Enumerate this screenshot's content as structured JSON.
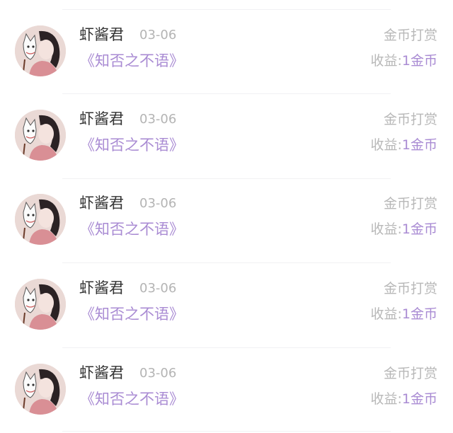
{
  "items": [
    {
      "user": "虾酱君",
      "date": "03-06",
      "book": "《知否之不语》",
      "type": "金币打赏",
      "income_label": "收益:",
      "income_value": "1金币",
      "avatar": "avatar-woman-with-fox-mask"
    },
    {
      "user": "虾酱君",
      "date": "03-06",
      "book": "《知否之不语》",
      "type": "金币打赏",
      "income_label": "收益:",
      "income_value": "1金币",
      "avatar": "avatar-woman-with-fox-mask"
    },
    {
      "user": "虾酱君",
      "date": "03-06",
      "book": "《知否之不语》",
      "type": "金币打赏",
      "income_label": "收益:",
      "income_value": "1金币",
      "avatar": "avatar-woman-with-fox-mask"
    },
    {
      "user": "虾酱君",
      "date": "03-06",
      "book": "《知否之不语》",
      "type": "金币打赏",
      "income_label": "收益:",
      "income_value": "1金币",
      "avatar": "avatar-woman-with-fox-mask"
    },
    {
      "user": "虾酱君",
      "date": "03-06",
      "book": "《知否之不语》",
      "type": "金币打赏",
      "income_label": "收益:",
      "income_value": "1金币",
      "avatar": "avatar-woman-with-fox-mask"
    }
  ],
  "colors": {
    "accent": "#a98bd3",
    "name": "#333333",
    "muted": "#b8b8b8",
    "divider": "#f1f1f3"
  }
}
